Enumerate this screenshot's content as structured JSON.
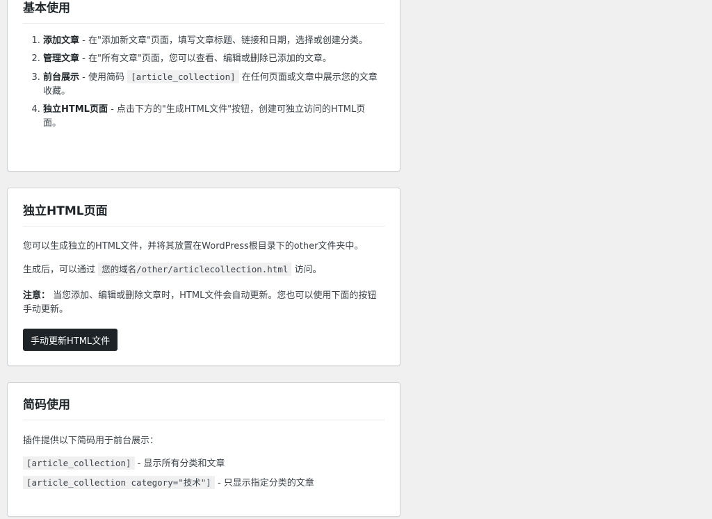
{
  "basic_usage": {
    "title": "基本使用",
    "steps": [
      {
        "label": "添加文章",
        "text": " - 在\"添加新文章\"页面，填写文章标题、链接和日期，选择或创建分类。"
      },
      {
        "label": "管理文章",
        "text": " - 在\"所有文章\"页面，您可以查看、编辑或删除已添加的文章。"
      },
      {
        "label": "前台展示",
        "text_before": " - 使用简码 ",
        "code": "[article_collection]",
        "text_after": " 在任何页面或文章中展示您的文章收藏。"
      },
      {
        "label": "独立HTML页面",
        "text": " - 点击下方的\"生成HTML文件\"按钮，创建可独立访问的HTML页面。"
      }
    ]
  },
  "standalone_html": {
    "title": "独立HTML页面",
    "intro": "您可以生成独立的HTML文件，并将其放置在WordPress根目录下的other文件夹中。",
    "access_before": "生成后，可以通过 ",
    "access_code": "您的域名/other/articlecollection.html",
    "access_after": " 访问。",
    "note_label": "注意：",
    "note_text": " 当您添加、编辑或删除文章时，HTML文件会自动更新。您也可以使用下面的按钮手动更新。",
    "update_button_label": "手动更新HTML文件"
  },
  "shortcode_usage": {
    "title": "简码使用",
    "intro": "插件提供以下简码用于前台展示：",
    "items": [
      {
        "code": "[article_collection]",
        "desc": " - 显示所有分类和文章"
      },
      {
        "code": "[article_collection category=\"技术\"]",
        "desc": " - 只显示指定分类的文章"
      }
    ]
  }
}
